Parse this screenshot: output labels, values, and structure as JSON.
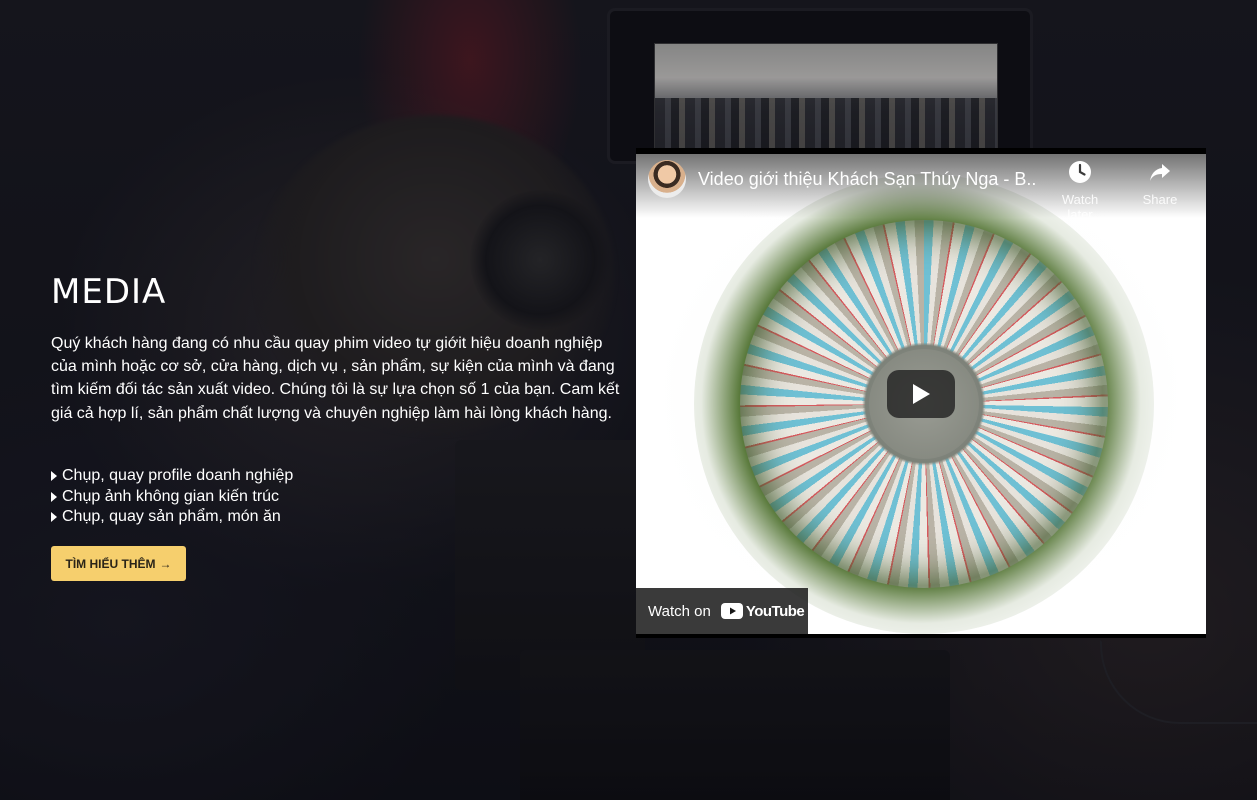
{
  "section": {
    "title": "MEDIA",
    "description": "Quý khách hàng đang có nhu cầu quay phim video tự giớit hiệu doanh nghiệp của mình hoặc cơ sở, cửa hàng, dịch vụ , sản phẩm, sự kiện của mình và đang tìm kiếm đối tác sản xuất video. Chúng tôi là sự lựa chọn số 1 của bạn. Cam kết giá cả hợp lí, sản phẩm chất lượng và chuyên nghiệp làm hài lòng khách hàng.",
    "features": [
      "Chụp, quay profile doanh nghiệp",
      "Chụp ảnh không gian kiến trúc",
      "Chụp, quay sản phẩm, món ăn"
    ],
    "cta_label": "TÌM HIỂU THÊM",
    "cta_arrow": "→"
  },
  "video": {
    "title": "Video giới thiệu Khách Sạn Thúy Nga - B...",
    "watch_later_label": "Watch later",
    "share_label": "Share",
    "watch_on_label": "Watch on",
    "youtube_word": "YouTube"
  },
  "colors": {
    "accent": "#f6cf6d",
    "text": "#ffffff",
    "background": "#14161c"
  },
  "icons": {
    "feature_bullet": "caret-right-icon",
    "watch_later": "clock-icon",
    "share": "share-arrow-icon",
    "play": "play-icon",
    "youtube": "youtube-logo-icon"
  }
}
